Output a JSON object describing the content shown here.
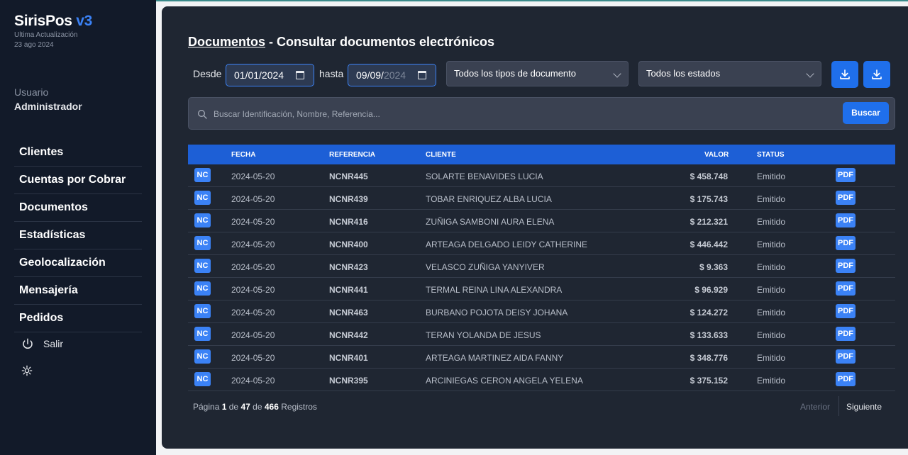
{
  "app": {
    "name": "SirisPos",
    "version": "v3",
    "update_label": "Ultima Actualización",
    "update_date": "23 ago 2024"
  },
  "user": {
    "label": "Usuario",
    "name": "Administrador"
  },
  "sidebar": {
    "items": [
      {
        "label": "Clientes"
      },
      {
        "label": "Cuentas por Cobrar"
      },
      {
        "label": "Documentos"
      },
      {
        "label": "Estadísticas"
      },
      {
        "label": "Geolocalización"
      },
      {
        "label": "Mensajería"
      },
      {
        "label": "Pedidos"
      }
    ],
    "logout": "Salir",
    "theme_icon": "sun-icon",
    "logout_icon": "power-icon"
  },
  "page": {
    "title_link": "Documentos",
    "title_rest": " - Consultar documentos electrónicos"
  },
  "filters": {
    "desde_label": "Desde",
    "desde_value": "01/01/2024",
    "hasta_label": "hasta",
    "hasta_value_set": "09/09/",
    "hasta_value_dim": "2024",
    "tipo": "Todos los tipos de documento",
    "estado": "Todos los estados"
  },
  "search": {
    "placeholder": "Buscar Identificación, Nombre, Referencia...",
    "value": "",
    "button": "Buscar"
  },
  "table": {
    "headers": {
      "fecha": "FECHA",
      "referencia": "REFERENCIA",
      "cliente": "CLIENTE",
      "valor": "VALOR",
      "status": "STATUS"
    },
    "rows": [
      {
        "tipo": "NC",
        "fecha": "2024-05-20",
        "referencia": "NCNR445",
        "cliente": "SOLARTE BENAVIDES LUCIA",
        "valor": "$ 458.748",
        "status": "Emitido",
        "pdf": "PDF"
      },
      {
        "tipo": "NC",
        "fecha": "2024-05-20",
        "referencia": "NCNR439",
        "cliente": "TOBAR ENRIQUEZ ALBA LUCIA",
        "valor": "$ 175.743",
        "status": "Emitido",
        "pdf": "PDF"
      },
      {
        "tipo": "NC",
        "fecha": "2024-05-20",
        "referencia": "NCNR416",
        "cliente": "ZUÑIGA SAMBONI AURA ELENA",
        "valor": "$ 212.321",
        "status": "Emitido",
        "pdf": "PDF"
      },
      {
        "tipo": "NC",
        "fecha": "2024-05-20",
        "referencia": "NCNR400",
        "cliente": "ARTEAGA DELGADO LEIDY CATHERINE",
        "valor": "$ 446.442",
        "status": "Emitido",
        "pdf": "PDF"
      },
      {
        "tipo": "NC",
        "fecha": "2024-05-20",
        "referencia": "NCNR423",
        "cliente": "VELASCO ZUÑIGA YANYIVER",
        "valor": "$ 9.363",
        "status": "Emitido",
        "pdf": "PDF"
      },
      {
        "tipo": "NC",
        "fecha": "2024-05-20",
        "referencia": "NCNR441",
        "cliente": "TERMAL REINA LINA ALEXANDRA",
        "valor": "$ 96.929",
        "status": "Emitido",
        "pdf": "PDF"
      },
      {
        "tipo": "NC",
        "fecha": "2024-05-20",
        "referencia": "NCNR463",
        "cliente": "BURBANO POJOTA DEISY JOHANA",
        "valor": "$ 124.272",
        "status": "Emitido",
        "pdf": "PDF"
      },
      {
        "tipo": "NC",
        "fecha": "2024-05-20",
        "referencia": "NCNR442",
        "cliente": "TERAN YOLANDA DE JESUS",
        "valor": "$ 133.633",
        "status": "Emitido",
        "pdf": "PDF"
      },
      {
        "tipo": "NC",
        "fecha": "2024-05-20",
        "referencia": "NCNR401",
        "cliente": "ARTEAGA MARTINEZ AIDA FANNY",
        "valor": "$ 348.776",
        "status": "Emitido",
        "pdf": "PDF"
      },
      {
        "tipo": "NC",
        "fecha": "2024-05-20",
        "referencia": "NCNR395",
        "cliente": "ARCINIEGAS CERON ANGELA YELENA",
        "valor": "$ 375.152",
        "status": "Emitido",
        "pdf": "PDF"
      }
    ]
  },
  "pagination": {
    "pagina_label": "Página",
    "current": "1",
    "de1": "de",
    "total_pages": "47",
    "de2": "de",
    "total_records": "466",
    "registros_label": "Registros",
    "prev": "Anterior",
    "next": "Siguiente"
  },
  "colors": {
    "accent": "#1f6feb",
    "sidebar_bg": "#121a29",
    "panel_bg": "#1f2632",
    "header_bg": "#1d5fd6"
  }
}
